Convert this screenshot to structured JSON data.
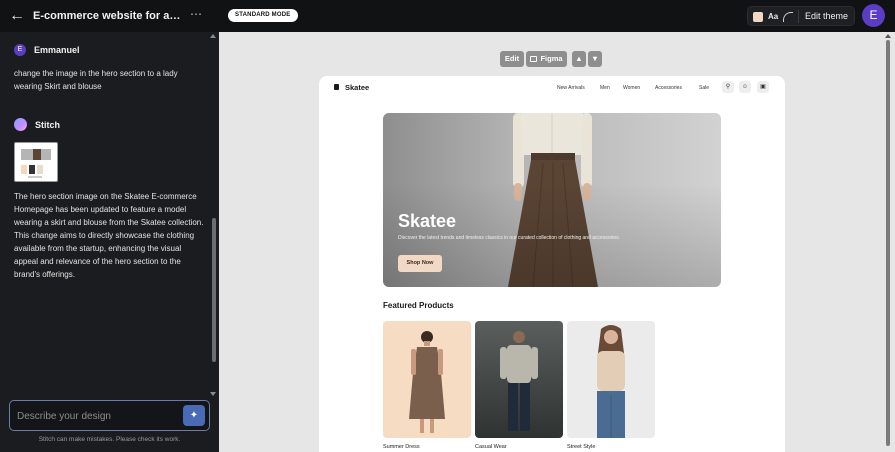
{
  "header": {
    "project_title": "E-commerce website for a cloth...",
    "mode_badge": "STANDARD MODE",
    "font_button": "Aa",
    "edit_theme_label": "Edit theme",
    "user_initial": "E",
    "accent_color": "#5b3cc4"
  },
  "chat": {
    "messages": [
      {
        "author": "Emmanuel",
        "initial": "E",
        "text": "change the image in the hero section to a lady wearing Skirt and blouse"
      },
      {
        "author": "Stitch",
        "text": "The hero section image on the Skatee E-commerce Homepage has been updated to feature a model wearing a skirt and blouse from the Skatee collection. This change aims to directly showcase the clothing available from the startup, enhancing the visual appeal and relevance of the hero section to the brand's offerings."
      }
    ],
    "input_placeholder": "Describe your design",
    "disclaimer": "Stitch can make mistakes. Please check its work."
  },
  "canvas_toolbar": {
    "edit_label": "Edit",
    "figma_label": "Figma"
  },
  "preview": {
    "brand": "Skatee",
    "nav_links": [
      "New Arrivals",
      "Men",
      "Women",
      "Accessories",
      "Sale"
    ],
    "hero": {
      "title": "Skatee",
      "subtitle": "Discover the latest trends and timeless classics in our curated collection of clothing and accessories.",
      "cta": "Shop Now"
    },
    "featured_title": "Featured Products",
    "products": [
      {
        "name": "Summer Dress"
      },
      {
        "name": "Casual Wear"
      },
      {
        "name": "Street Style"
      }
    ]
  }
}
